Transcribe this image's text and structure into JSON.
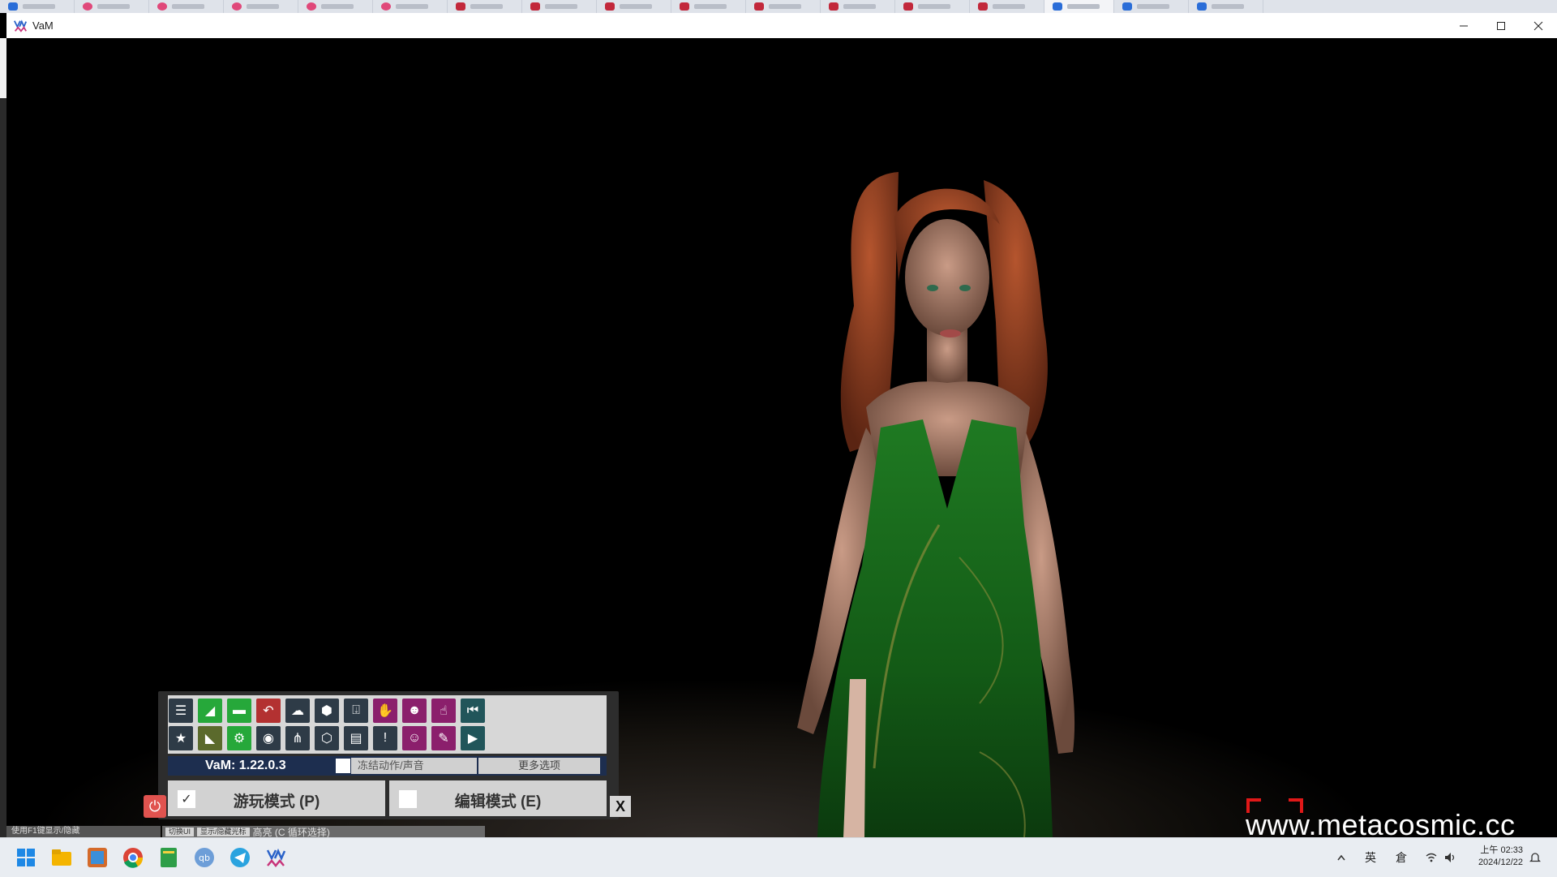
{
  "window": {
    "title": "VaM",
    "controls": [
      "minimize",
      "maximize",
      "close"
    ]
  },
  "toolbar": {
    "row1_icons": [
      "menu-icon",
      "open-scene-icon",
      "folder-icon",
      "undo-scene-icon",
      "cloud-icon",
      "package-icon",
      "inbox-icon",
      "hand-icon",
      "person-select-icon",
      "pointer-hand-icon",
      "skip-back-icon"
    ],
    "row2_icons": [
      "star-icon",
      "save-scene-icon",
      "folder-settings-icon",
      "camera-icon",
      "network-icon",
      "package-stack-icon",
      "document-icon",
      "alert-icon",
      "person-edit-icon",
      "wrench-hand-icon",
      "play-icon"
    ],
    "version": "VaM: 1.22.0.3",
    "freeze_label": "冻结动作/声音",
    "more_options": "更多选项",
    "play_mode": "游玩模式 (P)",
    "edit_mode": "编辑模式 (E)",
    "close": "X"
  },
  "bottom_bar": {
    "hint": "使用F1键显示/隐藏",
    "toggle_ui": "切换UI",
    "show_cursor": "显示/隐藏光标",
    "highlight": "高亮 (C 循环选择)"
  },
  "watermark": "www.metacosmic.cc",
  "taskbar": {
    "apps": [
      "windows-start-icon",
      "file-explorer-icon",
      "photos-icon",
      "chrome-icon",
      "notepad-icon",
      "qbittorrent-icon",
      "telegram-icon",
      "vam-icon"
    ],
    "tray": {
      "ime_lang": "英",
      "ime_mode": "倉"
    },
    "time": "上午 02:33",
    "date": "2024/12/22"
  },
  "colors": {
    "accent_green": "#26a83a",
    "accent_purple": "#8b1f6c",
    "version_bar": "#1d2e4f",
    "power_red": "#e0534f"
  }
}
